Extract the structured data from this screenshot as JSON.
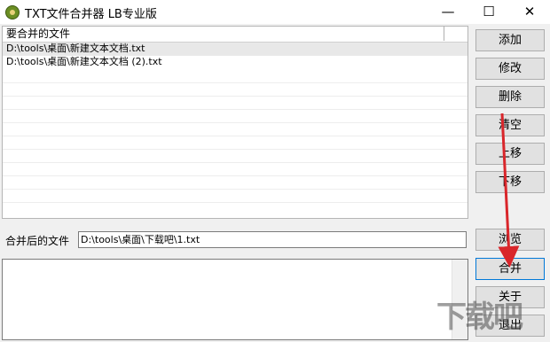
{
  "window": {
    "title": "TXT文件合并器 LB专业版",
    "minimize": "—",
    "maximize": "☐",
    "close": "✕"
  },
  "file_list": {
    "column_header": "要合并的文件",
    "items": [
      "D:\\tools\\桌面\\新建文本文档.txt",
      "D:\\tools\\桌面\\新建文本文档 (2).txt"
    ]
  },
  "buttons": {
    "add": "添加",
    "modify": "修改",
    "delete": "删除",
    "clear": "清空",
    "move_up": "上移",
    "move_down": "下移",
    "browse": "浏览",
    "merge": "合并",
    "about": "关于",
    "exit": "退出"
  },
  "output": {
    "label": "合并后的文件",
    "value": "D:\\tools\\桌面\\下载吧\\1.txt"
  },
  "annotation_color": "#d9262b",
  "watermark_text": "下载吧"
}
